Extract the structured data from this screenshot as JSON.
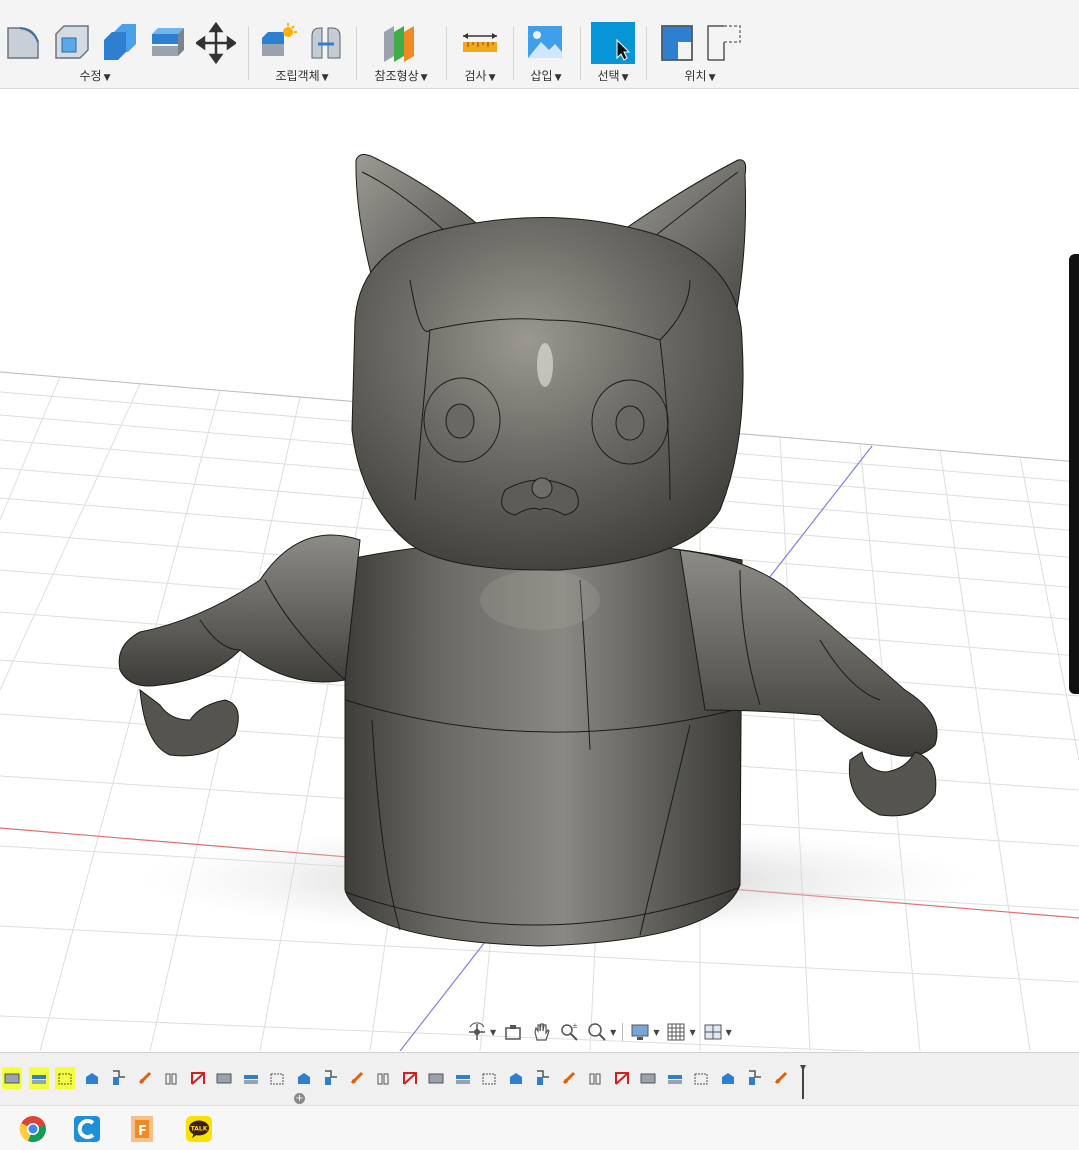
{
  "toolbar": {
    "groups": [
      {
        "label": "수정",
        "icons": [
          "press-pull-icon",
          "fillet-icon",
          "shell-icon",
          "combine-icon",
          "offset-face-icon",
          "move-copy-icon"
        ]
      },
      {
        "label": "조립객체",
        "icons": [
          "new-component-icon",
          "joint-icon"
        ]
      },
      {
        "label": "참조형상",
        "icons": [
          "offset-plane-icon"
        ]
      },
      {
        "label": "검사",
        "icons": [
          "measure-icon"
        ]
      },
      {
        "label": "삽입",
        "icons": [
          "insert-image-icon"
        ]
      },
      {
        "label": "선택",
        "icons": [
          "select-icon"
        ]
      },
      {
        "label": "위치",
        "icons": [
          "capture-position-icon",
          "revert-position-icon"
        ]
      }
    ],
    "active_group": "선택"
  },
  "navigation_bar": {
    "tools": [
      "orbit-icon",
      "look-at-icon",
      "pan-icon",
      "zoom-icon",
      "fit-icon",
      "display-settings-icon",
      "grid-settings-icon",
      "viewports-icon"
    ]
  },
  "timeline": {
    "highlighted_items": 3,
    "item_count": 30
  },
  "taskbar": {
    "apps": [
      "chrome-icon",
      "ccleaner-icon",
      "fusion-icon",
      "kakaotalk-icon"
    ],
    "kakao_badge": "TALK"
  },
  "colors": {
    "accent": "#0696d7",
    "model": "#6b6a64",
    "grid": "#dcdcdc",
    "highlight": "#f2ff3a",
    "x_axis": "#e07070",
    "y_axis": "#8080e0"
  }
}
